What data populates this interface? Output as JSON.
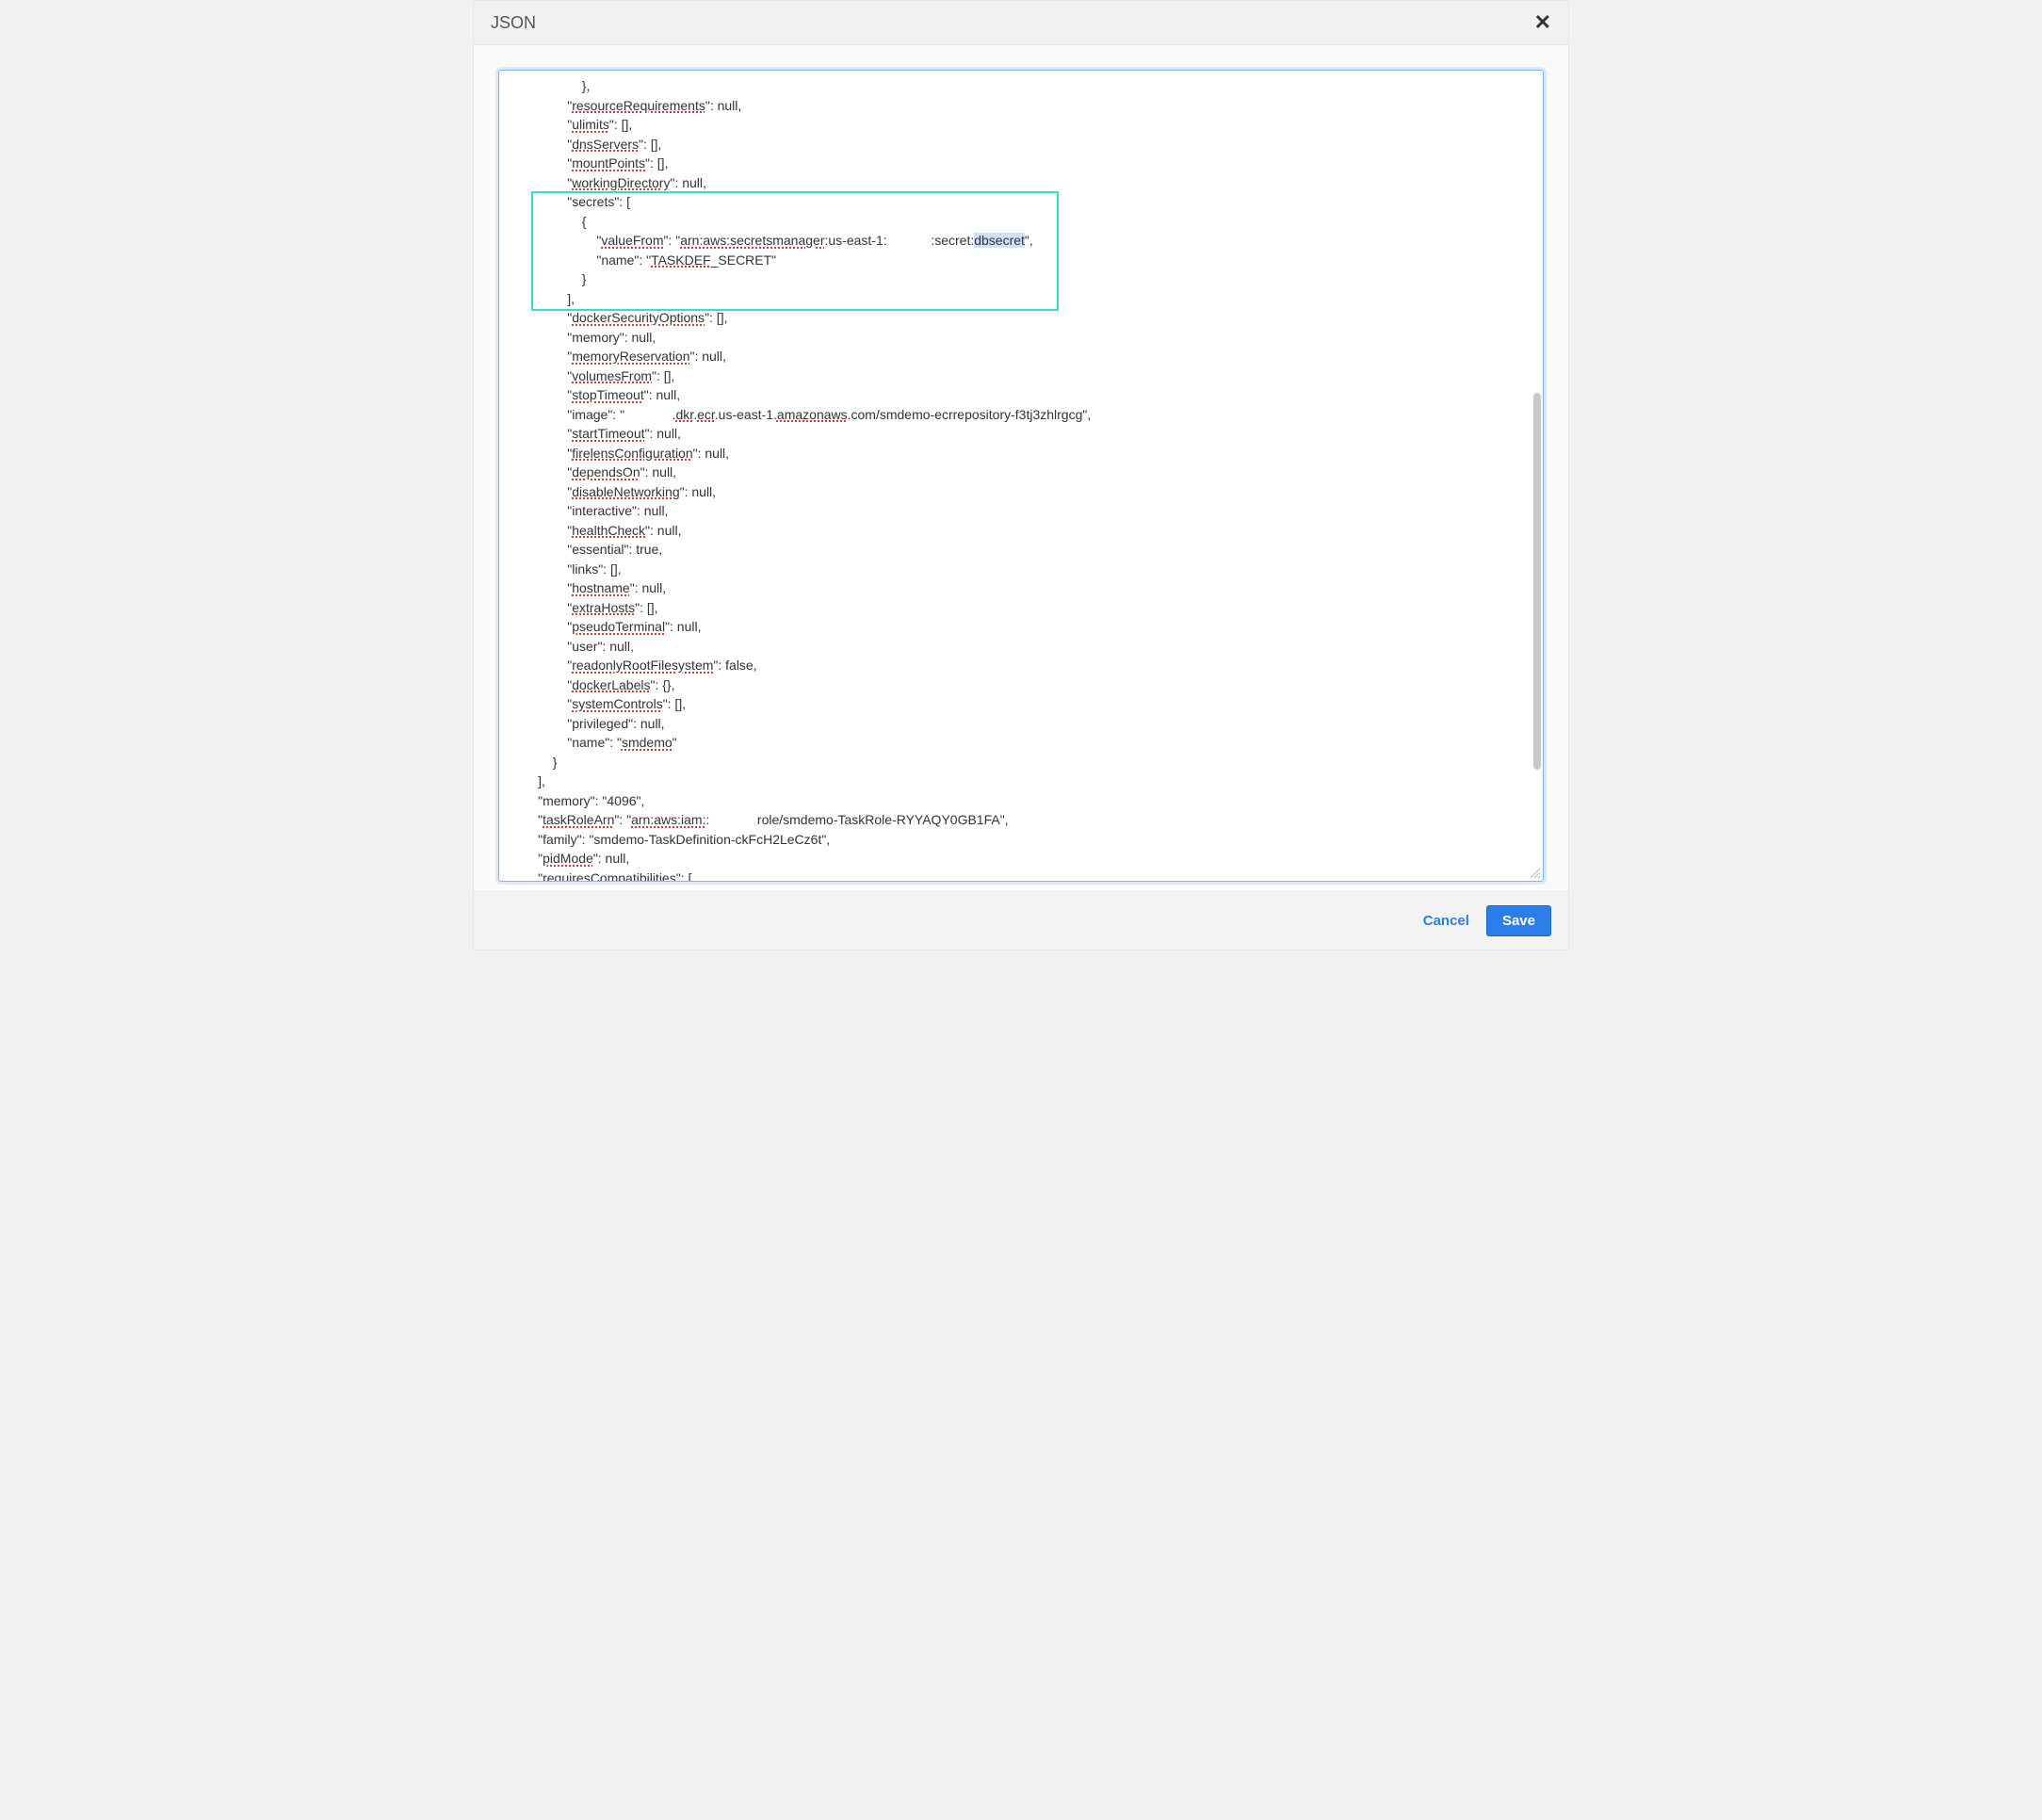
{
  "modal": {
    "title": "JSON",
    "cancel_label": "Cancel",
    "save_label": "Save"
  },
  "highlight": {
    "selected_text": "dbsecret",
    "box_target_lines": [
      6,
      11
    ]
  },
  "json_content": {
    "resourceRequirements": null,
    "ulimits": [],
    "dnsServers": [],
    "mountPoints": [],
    "workingDirectory": null,
    "secrets": [
      {
        "valueFrom": "arn:aws:secretsmanager:us-east-1:            :secret:dbsecret",
        "name": "TASKDEF_SECRET"
      }
    ],
    "dockerSecurityOptions": [],
    "memory_container": null,
    "memoryReservation": null,
    "volumesFrom": [],
    "stopTimeout": null,
    "image": "             .dkr.ecr.us-east-1.amazonaws.com/smdemo-ecrrepository-f3tj3zhlrgcg",
    "startTimeout": null,
    "firelensConfiguration": null,
    "dependsOn": null,
    "disableNetworking": null,
    "interactive": null,
    "healthCheck": null,
    "essential": true,
    "links": [],
    "hostname": null,
    "extraHosts": [],
    "pseudoTerminal": null,
    "user": null,
    "readonlyRootFilesystem": false,
    "dockerLabels": {},
    "systemControls": [],
    "privileged": null,
    "name_container": "smdemo",
    "memory": "4096",
    "taskRoleArn": "arn:aws:iam::             role/smdemo-TaskRole-RYYAQY0GB1FA",
    "family": "smdemo-TaskDefinition-ckFcH2LeCz6t",
    "pidMode": null,
    "requiresCompatibilities_open": "["
  },
  "lines": [
    {
      "indent": 5,
      "segs": [
        {
          "t": "},"
        }
      ]
    },
    {
      "indent": 4,
      "segs": [
        {
          "t": "\""
        },
        {
          "t": "resourceRequirements",
          "sc": true
        },
        {
          "t": "\": null,"
        }
      ]
    },
    {
      "indent": 4,
      "segs": [
        {
          "t": "\""
        },
        {
          "t": "ulimits",
          "sc": true
        },
        {
          "t": "\": [],"
        }
      ]
    },
    {
      "indent": 4,
      "segs": [
        {
          "t": "\""
        },
        {
          "t": "dnsServers",
          "sc": true
        },
        {
          "t": "\": [],"
        }
      ]
    },
    {
      "indent": 4,
      "segs": [
        {
          "t": "\""
        },
        {
          "t": "mountPoints",
          "sc": true
        },
        {
          "t": "\": [],"
        }
      ]
    },
    {
      "indent": 4,
      "segs": [
        {
          "t": "\""
        },
        {
          "t": "workingDirectory",
          "sc": true
        },
        {
          "t": "\": null,"
        }
      ]
    },
    {
      "indent": 4,
      "segs": [
        {
          "t": "\"secrets\": ["
        }
      ]
    },
    {
      "indent": 5,
      "segs": [
        {
          "t": "{"
        }
      ]
    },
    {
      "indent": 6,
      "segs": [
        {
          "t": "\""
        },
        {
          "t": "valueFrom",
          "sc": true
        },
        {
          "t": "\": \""
        },
        {
          "t": "arn:aws:secretsmanager",
          "sc": true
        },
        {
          "t": ":us-east-1:            :secret:"
        },
        {
          "t": "dbsecret",
          "sel": true
        },
        {
          "t": "\","
        }
      ]
    },
    {
      "indent": 6,
      "segs": [
        {
          "t": "\"name\": \""
        },
        {
          "t": "TASKDEF",
          "sc": true
        },
        {
          "t": "_SECRET\""
        }
      ]
    },
    {
      "indent": 5,
      "segs": [
        {
          "t": "}"
        }
      ]
    },
    {
      "indent": 4,
      "segs": [
        {
          "t": "],"
        }
      ]
    },
    {
      "indent": 4,
      "segs": [
        {
          "t": "\""
        },
        {
          "t": "dockerSecurityOptions",
          "sc": true
        },
        {
          "t": "\": [],"
        }
      ]
    },
    {
      "indent": 4,
      "segs": [
        {
          "t": "\"memory\": null,"
        }
      ]
    },
    {
      "indent": 4,
      "segs": [
        {
          "t": "\""
        },
        {
          "t": "memoryReservation",
          "sc": true
        },
        {
          "t": "\": null,"
        }
      ]
    },
    {
      "indent": 4,
      "segs": [
        {
          "t": "\""
        },
        {
          "t": "volumesFrom",
          "sc": true
        },
        {
          "t": "\": [],"
        }
      ]
    },
    {
      "indent": 4,
      "segs": [
        {
          "t": "\""
        },
        {
          "t": "stopTimeout",
          "sc": true
        },
        {
          "t": "\": null,"
        }
      ]
    },
    {
      "indent": 4,
      "segs": [
        {
          "t": "\"image\": \"             ."
        },
        {
          "t": "dkr",
          "sc": true
        },
        {
          "t": "."
        },
        {
          "t": "ecr",
          "sc": true
        },
        {
          "t": ".us-east-1."
        },
        {
          "t": "amazonaws",
          "sc": true
        },
        {
          "t": ".com/smdemo-ecrrepository-f3tj3zhlrgcg\","
        }
      ]
    },
    {
      "indent": 4,
      "segs": [
        {
          "t": "\""
        },
        {
          "t": "startTimeout",
          "sc": true
        },
        {
          "t": "\": null,"
        }
      ]
    },
    {
      "indent": 4,
      "segs": [
        {
          "t": "\""
        },
        {
          "t": "firelensConfiguration",
          "sc": true
        },
        {
          "t": "\": null,"
        }
      ]
    },
    {
      "indent": 4,
      "segs": [
        {
          "t": "\""
        },
        {
          "t": "dependsOn",
          "sc": true
        },
        {
          "t": "\": null,"
        }
      ]
    },
    {
      "indent": 4,
      "segs": [
        {
          "t": "\""
        },
        {
          "t": "disableNetworking",
          "sc": true
        },
        {
          "t": "\": null,"
        }
      ]
    },
    {
      "indent": 4,
      "segs": [
        {
          "t": "\"interactive\": null,"
        }
      ]
    },
    {
      "indent": 4,
      "segs": [
        {
          "t": "\""
        },
        {
          "t": "healthCheck",
          "sc": true
        },
        {
          "t": "\": null,"
        }
      ]
    },
    {
      "indent": 4,
      "segs": [
        {
          "t": "\"essential\": true,"
        }
      ]
    },
    {
      "indent": 4,
      "segs": [
        {
          "t": "\"links\": [],"
        }
      ]
    },
    {
      "indent": 4,
      "segs": [
        {
          "t": "\""
        },
        {
          "t": "hostname",
          "sc": true
        },
        {
          "t": "\": null,"
        }
      ]
    },
    {
      "indent": 4,
      "segs": [
        {
          "t": "\""
        },
        {
          "t": "extraHosts",
          "sc": true
        },
        {
          "t": "\": [],"
        }
      ]
    },
    {
      "indent": 4,
      "segs": [
        {
          "t": "\""
        },
        {
          "t": "pseudoTerminal",
          "sc": true
        },
        {
          "t": "\": null,"
        }
      ]
    },
    {
      "indent": 4,
      "segs": [
        {
          "t": "\"user\": null,"
        }
      ]
    },
    {
      "indent": 4,
      "segs": [
        {
          "t": "\""
        },
        {
          "t": "readonlyRootFilesystem",
          "sc": true
        },
        {
          "t": "\": false,"
        }
      ]
    },
    {
      "indent": 4,
      "segs": [
        {
          "t": "\""
        },
        {
          "t": "dockerLabels",
          "sc": true
        },
        {
          "t": "\": {},"
        }
      ]
    },
    {
      "indent": 4,
      "segs": [
        {
          "t": "\""
        },
        {
          "t": "systemControls",
          "sc": true
        },
        {
          "t": "\": [],"
        }
      ]
    },
    {
      "indent": 4,
      "segs": [
        {
          "t": "\"privileged\": null,"
        }
      ]
    },
    {
      "indent": 4,
      "segs": [
        {
          "t": "\"name\": \""
        },
        {
          "t": "smdemo",
          "sc": true
        },
        {
          "t": "\""
        }
      ]
    },
    {
      "indent": 3,
      "segs": [
        {
          "t": "}"
        }
      ]
    },
    {
      "indent": 2,
      "segs": [
        {
          "t": "],"
        }
      ]
    },
    {
      "indent": 2,
      "segs": [
        {
          "t": "\"memory\": \"4096\","
        }
      ]
    },
    {
      "indent": 2,
      "segs": [
        {
          "t": "\""
        },
        {
          "t": "taskRoleArn",
          "sc": true
        },
        {
          "t": "\": \""
        },
        {
          "t": "arn:aws:iam:",
          "sc": true
        },
        {
          "t": ":             role/smdemo-TaskRole-RYYAQY0GB1FA\","
        }
      ]
    },
    {
      "indent": 2,
      "segs": [
        {
          "t": "\"family\": \"smdemo-TaskDefinition-ckFcH2LeCz6t\","
        }
      ]
    },
    {
      "indent": 2,
      "segs": [
        {
          "t": "\""
        },
        {
          "t": "pidMode",
          "sc": true
        },
        {
          "t": "\": null,"
        }
      ]
    },
    {
      "indent": 2,
      "segs": [
        {
          "t": "\""
        },
        {
          "t": "requiresCompatibilities",
          "sc": true
        },
        {
          "t": "\": ["
        }
      ]
    }
  ]
}
